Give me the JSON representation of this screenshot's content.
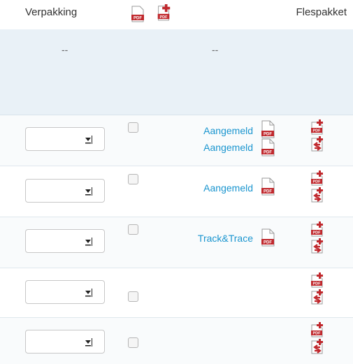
{
  "header": {
    "verpakking": "Verpakking",
    "flespakket": "Flespakket",
    "pdf_label": "PDF"
  },
  "banner": {
    "col1": "--",
    "col2": "--"
  },
  "rows": [
    {
      "statuses": [
        "Aangemeld",
        "Aangemeld"
      ]
    },
    {
      "statuses": [
        "Aangemeld"
      ]
    },
    {
      "statuses": [
        "Track&Trace"
      ]
    },
    {
      "statuses": []
    },
    {
      "statuses": []
    }
  ],
  "colors": {
    "link": "#1a95cf",
    "pdf_red": "#c0282d",
    "banner_bg": "#e9f1f7"
  }
}
